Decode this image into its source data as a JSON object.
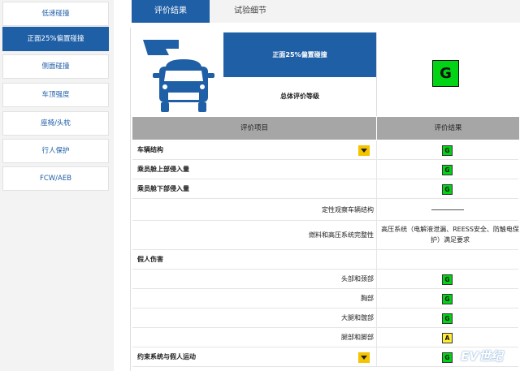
{
  "sidebar": {
    "items": [
      {
        "label": "低速碰撞",
        "active": false
      },
      {
        "label": "正面25%偏置碰撞",
        "active": true
      },
      {
        "label": "侧面碰撞",
        "active": false
      },
      {
        "label": "车顶强度",
        "active": false
      },
      {
        "label": "座椅/头枕",
        "active": false
      },
      {
        "label": "行人保护",
        "active": false
      },
      {
        "label": "FCW/AEB",
        "active": false
      }
    ]
  },
  "tabs": [
    {
      "label": "评价结果",
      "active": true
    },
    {
      "label": "试验细节",
      "active": false
    }
  ],
  "header": {
    "test_title": "正面25%偏置碰撞",
    "overall_label": "总体评价等级",
    "overall_grade": "G"
  },
  "table": {
    "col_item": "评价项目",
    "col_result": "评价结果",
    "rows": [
      {
        "label": "车辆结构",
        "style": "bold",
        "grade": "G",
        "dropdown": true
      },
      {
        "label": "乘员舱上部侵入量",
        "style": "bold",
        "grade": "G"
      },
      {
        "label": "乘员舱下部侵入量",
        "style": "bold",
        "grade": "G"
      },
      {
        "label": "定性观察车辆结构",
        "style": "right",
        "result_text": "——"
      },
      {
        "label": "燃料和高压系统完整性",
        "style": "right",
        "result_text": "高压系统（电解液泄漏、REESS安全、防触电保护）满足要求"
      },
      {
        "label": "假人伤害",
        "style": "bold"
      },
      {
        "label": "头部和颈部",
        "style": "right",
        "grade": "G"
      },
      {
        "label": "胸部",
        "style": "right",
        "grade": "G"
      },
      {
        "label": "大腿和髋部",
        "style": "right",
        "grade": "G"
      },
      {
        "label": "腿部和脚部",
        "style": "right",
        "grade": "A"
      },
      {
        "label": "约束系统与假人运动",
        "style": "bold",
        "grade": "G",
        "dropdown": true
      }
    ]
  },
  "icons": {
    "vehicle": "frontal-offset-crash-icon",
    "dropdown": "chevron-down-icon"
  },
  "colors": {
    "brand_blue": "#1f5fa6",
    "grade_good": "#00d414",
    "grade_acceptable": "#ffee33",
    "dropdown": "#f4c400"
  },
  "watermark": "EV世纪"
}
